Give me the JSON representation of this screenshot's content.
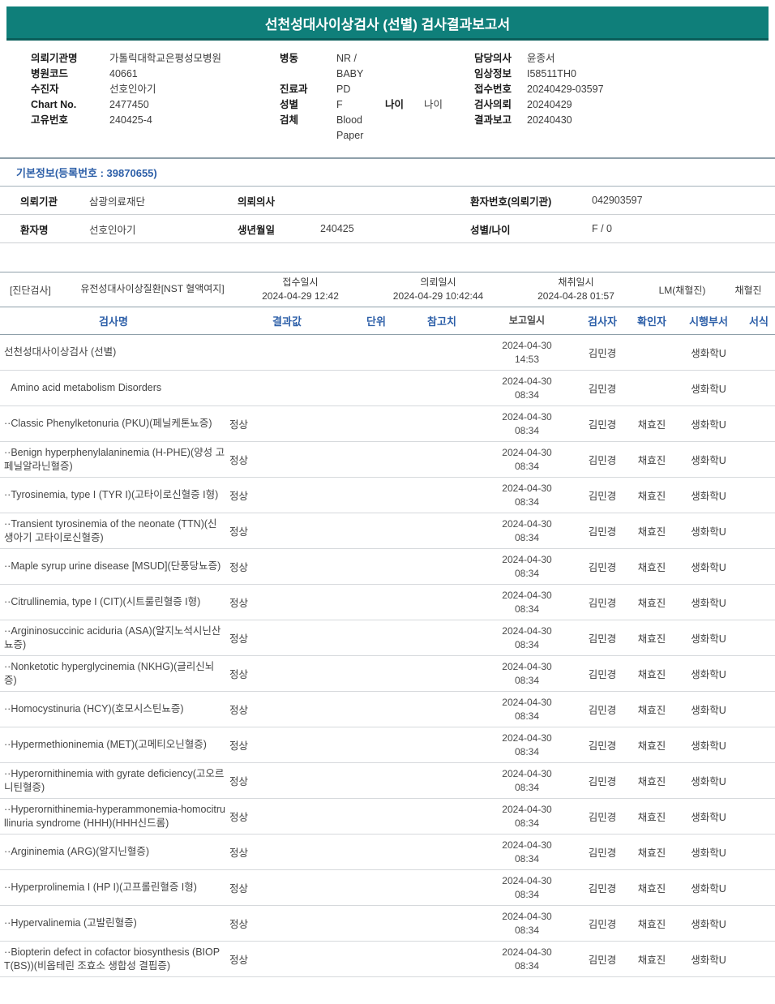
{
  "colors": {
    "header_bar": "#0f7f7a",
    "accent_text": "#2d5fa8"
  },
  "title": "선천성대사이상검사 (선별) 검사결과보고서",
  "patient_info": {
    "left": [
      {
        "label": "의뢰기관명",
        "value": "가톨릭대학교은평성모병원"
      },
      {
        "label": "병원코드",
        "value": "40661"
      },
      {
        "label": "수진자",
        "value": "선호인아기"
      },
      {
        "label": "Chart No.",
        "value": "2477450"
      },
      {
        "label": "고유번호",
        "value": "240425-4"
      }
    ],
    "middle": [
      {
        "label": "병동",
        "value": "NR / BABY"
      },
      {
        "label": "진료과",
        "value": "PD"
      },
      {
        "label": "성별",
        "value": "F",
        "label2": "나이",
        "value2": "나이"
      },
      {
        "label": "검체",
        "value": "Blood Paper"
      }
    ],
    "right": [
      {
        "label": "담당의사",
        "value": "윤종서"
      },
      {
        "label": "임상정보",
        "value": "I58511TH0"
      },
      {
        "label": "접수번호",
        "value": "20240429-03597"
      },
      {
        "label": "검사의뢰",
        "value": "20240429"
      },
      {
        "label": "결과보고",
        "value": "20240430"
      }
    ]
  },
  "basic_info": {
    "section_title": "기본정보(등록번호 : 39870655)",
    "rows": [
      {
        "c1_label": "의뢰기관",
        "c1_value": "삼광의료재단",
        "c2_label": "의뢰의사",
        "c2_value": "",
        "c3_label": "환자번호(의뢰기관)",
        "c3_value": "042903597"
      },
      {
        "c1_label": "환자명",
        "c1_value": "선호인아기",
        "c2_label": "생년월일",
        "c2_value": "240425",
        "c3_label": "성별/나이",
        "c3_value": "F / 0"
      }
    ]
  },
  "specimen": {
    "tag": "[진단검사]",
    "test_group": "유전성대사이상질환[NST 혈액여지]",
    "columns": [
      {
        "label": "접수일시",
        "value": "2024-04-29 12:42"
      },
      {
        "label": "의뢰일시",
        "value": "2024-04-29 10:42:44"
      },
      {
        "label": "채취일시",
        "value": "2024-04-28 01:57"
      }
    ],
    "collector": "LM(채혈진)",
    "collector_label": "채혈진"
  },
  "results_table": {
    "headers": [
      "검사명",
      "결과값",
      "단위",
      "참고치",
      "보고일시",
      "검사자",
      "확인자",
      "시행부서",
      "서식"
    ],
    "rows": [
      {
        "name": "선천성대사이상검사 (선별)",
        "indent": 0,
        "result": "",
        "unit": "",
        "ref": "",
        "reported_date": "2024-04-30",
        "reported_time": "14:53",
        "tester": "김민경",
        "confirmer": "",
        "dept": "생화학U",
        "form": ""
      },
      {
        "name": "Amino acid metabolism Disorders",
        "indent": 1,
        "result": "",
        "unit": "",
        "ref": "",
        "reported_date": "2024-04-30",
        "reported_time": "08:34",
        "tester": "김민경",
        "confirmer": "",
        "dept": "생화학U",
        "form": ""
      },
      {
        "name": "··Classic Phenylketonuria (PKU)(페닐케톤뇨증)",
        "indent": 0,
        "result": "정상",
        "unit": "",
        "ref": "",
        "reported_date": "2024-04-30",
        "reported_time": "08:34",
        "tester": "김민경",
        "confirmer": "채효진",
        "dept": "생화학U",
        "form": ""
      },
      {
        "name": "··Benign hyperphenylalaninemia (H-PHE)(양성 고페닐알라닌혈증)",
        "indent": 0,
        "result": "정상",
        "unit": "",
        "ref": "",
        "reported_date": "2024-04-30",
        "reported_time": "08:34",
        "tester": "김민경",
        "confirmer": "채효진",
        "dept": "생화학U",
        "form": ""
      },
      {
        "name": "··Tyrosinemia, type I (TYR I)(고타이로신혈증 I형)",
        "indent": 0,
        "result": "정상",
        "unit": "",
        "ref": "",
        "reported_date": "2024-04-30",
        "reported_time": "08:34",
        "tester": "김민경",
        "confirmer": "채효진",
        "dept": "생화학U",
        "form": ""
      },
      {
        "name": "··Transient tyrosinemia of the neonate (TTN)(신생아기 고타이로신혈증)",
        "indent": 0,
        "result": "정상",
        "unit": "",
        "ref": "",
        "reported_date": "2024-04-30",
        "reported_time": "08:34",
        "tester": "김민경",
        "confirmer": "채효진",
        "dept": "생화학U",
        "form": ""
      },
      {
        "name": "··Maple syrup urine disease [MSUD](단풍당뇨증)",
        "indent": 0,
        "result": "정상",
        "unit": "",
        "ref": "",
        "reported_date": "2024-04-30",
        "reported_time": "08:34",
        "tester": "김민경",
        "confirmer": "채효진",
        "dept": "생화학U",
        "form": ""
      },
      {
        "name": "··Citrullinemia, type I (CIT)(시트룰린혈증 I형)",
        "indent": 0,
        "result": "정상",
        "unit": "",
        "ref": "",
        "reported_date": "2024-04-30",
        "reported_time": "08:34",
        "tester": "김민경",
        "confirmer": "채효진",
        "dept": "생화학U",
        "form": ""
      },
      {
        "name": "··Argininosuccinic aciduria (ASA)(알지노석시닌산뇨증)",
        "indent": 0,
        "result": "정상",
        "unit": "",
        "ref": "",
        "reported_date": "2024-04-30",
        "reported_time": "08:34",
        "tester": "김민경",
        "confirmer": "채효진",
        "dept": "생화학U",
        "form": ""
      },
      {
        "name": "··Nonketotic hyperglycinemia (NKHG)(글리신뇌증)",
        "indent": 0,
        "result": "정상",
        "unit": "",
        "ref": "",
        "reported_date": "2024-04-30",
        "reported_time": "08:34",
        "tester": "김민경",
        "confirmer": "채효진",
        "dept": "생화학U",
        "form": ""
      },
      {
        "name": "··Homocystinuria (HCY)(호모시스틴뇨증)",
        "indent": 0,
        "result": "정상",
        "unit": "",
        "ref": "",
        "reported_date": "2024-04-30",
        "reported_time": "08:34",
        "tester": "김민경",
        "confirmer": "채효진",
        "dept": "생화학U",
        "form": ""
      },
      {
        "name": "··Hypermethioninemia (MET)(고메티오닌혈증)",
        "indent": 0,
        "result": "정상",
        "unit": "",
        "ref": "",
        "reported_date": "2024-04-30",
        "reported_time": "08:34",
        "tester": "김민경",
        "confirmer": "채효진",
        "dept": "생화학U",
        "form": ""
      },
      {
        "name": "··Hyperornithinemia with gyrate deficiency(고오르니틴혈증)",
        "indent": 0,
        "result": "정상",
        "unit": "",
        "ref": "",
        "reported_date": "2024-04-30",
        "reported_time": "08:34",
        "tester": "김민경",
        "confirmer": "채효진",
        "dept": "생화학U",
        "form": ""
      },
      {
        "name": "··Hyperornithinemia-hyperammonemia-homocitrullinuria syndrome (HHH)(HHH신드롬)",
        "indent": 0,
        "result": "정상",
        "unit": "",
        "ref": "",
        "reported_date": "2024-04-30",
        "reported_time": "08:34",
        "tester": "김민경",
        "confirmer": "채효진",
        "dept": "생화학U",
        "form": ""
      },
      {
        "name": "··Argininemia (ARG)(알지닌혈증)",
        "indent": 0,
        "result": "정상",
        "unit": "",
        "ref": "",
        "reported_date": "2024-04-30",
        "reported_time": "08:34",
        "tester": "김민경",
        "confirmer": "채효진",
        "dept": "생화학U",
        "form": ""
      },
      {
        "name": "··Hyperprolinemia I (HP I)(고프롤린혈증 I형)",
        "indent": 0,
        "result": "정상",
        "unit": "",
        "ref": "",
        "reported_date": "2024-04-30",
        "reported_time": "08:34",
        "tester": "김민경",
        "confirmer": "채효진",
        "dept": "생화학U",
        "form": ""
      },
      {
        "name": "··Hypervalinemia (고발린혈증)",
        "indent": 0,
        "result": "정상",
        "unit": "",
        "ref": "",
        "reported_date": "2024-04-30",
        "reported_time": "08:34",
        "tester": "김민경",
        "confirmer": "채효진",
        "dept": "생화학U",
        "form": ""
      },
      {
        "name": "··Biopterin defect in cofactor biosynthesis (BIOPT(BS))(비옵테린 조효소 생합성 결핍증)",
        "indent": 0,
        "result": "정상",
        "unit": "",
        "ref": "",
        "reported_date": "2024-04-30",
        "reported_time": "08:34",
        "tester": "김민경",
        "confirmer": "채효진",
        "dept": "생화학U",
        "form": ""
      }
    ]
  }
}
